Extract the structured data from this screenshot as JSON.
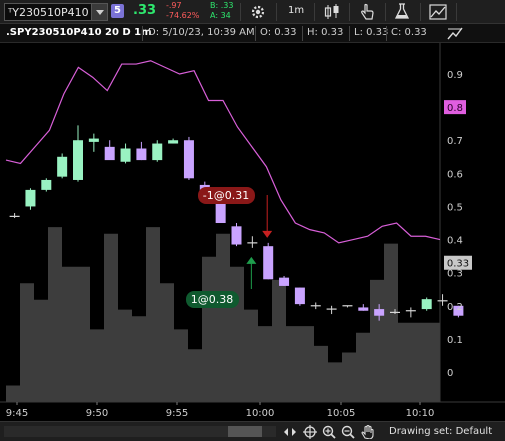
{
  "toolbar": {
    "symbol": "ᵀY230510P410",
    "link_group": "5",
    "last_price": ".33",
    "net_change": "-.97",
    "percent_change": "-74.62%",
    "bid": "B: .33",
    "ask": "A: 34",
    "timeframe": "1m",
    "icons": [
      "gear-icon",
      "candles-icon",
      "hand-pointer-icon",
      "flask-icon",
      "drawings-icon"
    ]
  },
  "info_bar": {
    "symbol_label": ".SPY230510P410 20 D 1m",
    "date": "D: 5/10/23, 10:39 AM",
    "open": "O: 0.33",
    "high": "H: 0.33",
    "low": "L: 0.33",
    "close": "C: 0.33"
  },
  "chart_data": {
    "type": "candlestick",
    "time_labels": [
      "9:45",
      "9:50",
      "9:55",
      "10:00",
      "10:05",
      "10:10"
    ],
    "y_ticks": [
      "0.9",
      "0.8",
      "0.7",
      "0.6",
      "0.5",
      "0.4",
      "0.3",
      "0.2",
      "0.1",
      "0"
    ],
    "ylim": [
      -0.05,
      1.0
    ],
    "candles": [
      {
        "o": 0.475,
        "h": 0.48,
        "l": 0.465,
        "c": 0.47
      },
      {
        "o": 0.5,
        "h": 0.555,
        "l": 0.49,
        "c": 0.55
      },
      {
        "o": 0.55,
        "h": 0.585,
        "l": 0.545,
        "c": 0.58
      },
      {
        "o": 0.59,
        "h": 0.66,
        "l": 0.585,
        "c": 0.65
      },
      {
        "o": 0.58,
        "h": 0.745,
        "l": 0.575,
        "c": 0.7
      },
      {
        "o": 0.695,
        "h": 0.72,
        "l": 0.665,
        "c": 0.705
      },
      {
        "o": 0.68,
        "h": 0.7,
        "l": 0.67,
        "c": 0.64
      },
      {
        "o": 0.635,
        "h": 0.69,
        "l": 0.63,
        "c": 0.675
      },
      {
        "o": 0.675,
        "h": 0.695,
        "l": 0.64,
        "c": 0.64
      },
      {
        "o": 0.64,
        "h": 0.7,
        "l": 0.635,
        "c": 0.69
      },
      {
        "o": 0.69,
        "h": 0.705,
        "l": 0.69,
        "c": 0.7
      },
      {
        "o": 0.7,
        "h": 0.71,
        "l": 0.58,
        "c": 0.585
      },
      {
        "o": 0.565,
        "h": 0.575,
        "l": 0.535,
        "c": 0.53
      },
      {
        "o": 0.51,
        "h": 0.54,
        "l": 0.45,
        "c": 0.45
      },
      {
        "o": 0.44,
        "h": 0.45,
        "l": 0.38,
        "c": 0.385
      },
      {
        "o": 0.39,
        "h": 0.41,
        "l": 0.375,
        "c": 0.39
      },
      {
        "o": 0.38,
        "h": 0.39,
        "l": 0.28,
        "c": 0.28
      },
      {
        "o": 0.285,
        "h": 0.29,
        "l": 0.26,
        "c": 0.26
      },
      {
        "o": 0.255,
        "h": 0.255,
        "l": 0.2,
        "c": 0.205
      },
      {
        "o": 0.205,
        "h": 0.21,
        "l": 0.19,
        "c": 0.2
      },
      {
        "o": 0.19,
        "h": 0.2,
        "l": 0.175,
        "c": 0.19
      },
      {
        "o": 0.2,
        "h": 0.2,
        "l": 0.195,
        "c": 0.2
      },
      {
        "o": 0.195,
        "h": 0.205,
        "l": 0.185,
        "c": 0.185
      },
      {
        "o": 0.19,
        "h": 0.205,
        "l": 0.155,
        "c": 0.17
      },
      {
        "o": 0.185,
        "h": 0.19,
        "l": 0.175,
        "c": 0.18
      },
      {
        "o": 0.185,
        "h": 0.195,
        "l": 0.165,
        "c": 0.185
      },
      {
        "o": 0.19,
        "h": 0.225,
        "l": 0.185,
        "c": 0.22
      },
      {
        "o": 0.215,
        "h": 0.235,
        "l": 0.2,
        "c": 0.215
      },
      {
        "o": 0.2,
        "h": 0.2,
        "l": 0.165,
        "c": 0.17
      }
    ],
    "volume_profile": [
      0.05,
      0.36,
      0.31,
      0.53,
      0.41,
      0.41,
      0.22,
      0.51,
      0.28,
      0.26,
      0.53,
      0.36,
      0.22,
      0.16,
      0.44,
      0.51,
      0.41,
      0.28,
      0.23,
      0.37,
      0.23,
      0.23,
      0.17,
      0.12,
      0.15,
      0.21,
      0.37,
      0.48,
      0.24,
      0.24,
      0.24
    ],
    "overlay_series": {
      "name": "",
      "color": "#d85fd8",
      "values": [
        0.64,
        0.63,
        0.68,
        0.73,
        0.84,
        0.92,
        0.89,
        0.85,
        0.93,
        0.93,
        0.94,
        0.92,
        0.9,
        0.91,
        0.82,
        0.82,
        0.74,
        0.68,
        0.62,
        0.52,
        0.45,
        0.43,
        0.42,
        0.39,
        0.4,
        0.41,
        0.44,
        0.45,
        0.41,
        0.41,
        0.4
      ]
    },
    "trade_sell": {
      "label": "-1@0.31",
      "candle": 16
    },
    "trade_buy": {
      "label": "1@0.38",
      "candle": 15
    },
    "price_badge_overlay": {
      "label": "0.8",
      "color": "#e05ee0"
    },
    "price_badge_last": {
      "label": "0.33",
      "color": "#c8c8c8"
    }
  },
  "bottom_bar": {
    "drawing_set": "Drawing set: Default",
    "tools": [
      "expand-icon",
      "crosshair-icon",
      "zoom-in-icon",
      "zoom-out-icon",
      "pan-hand-icon"
    ]
  },
  "colors": {
    "up_candle": "#99f2c2",
    "down_candle": "#c9a3ff",
    "overlay": "#d85fd8",
    "volume": "#3d3d3d",
    "sell_marker": "#8a1818",
    "buy_marker": "#0f5a2f"
  }
}
